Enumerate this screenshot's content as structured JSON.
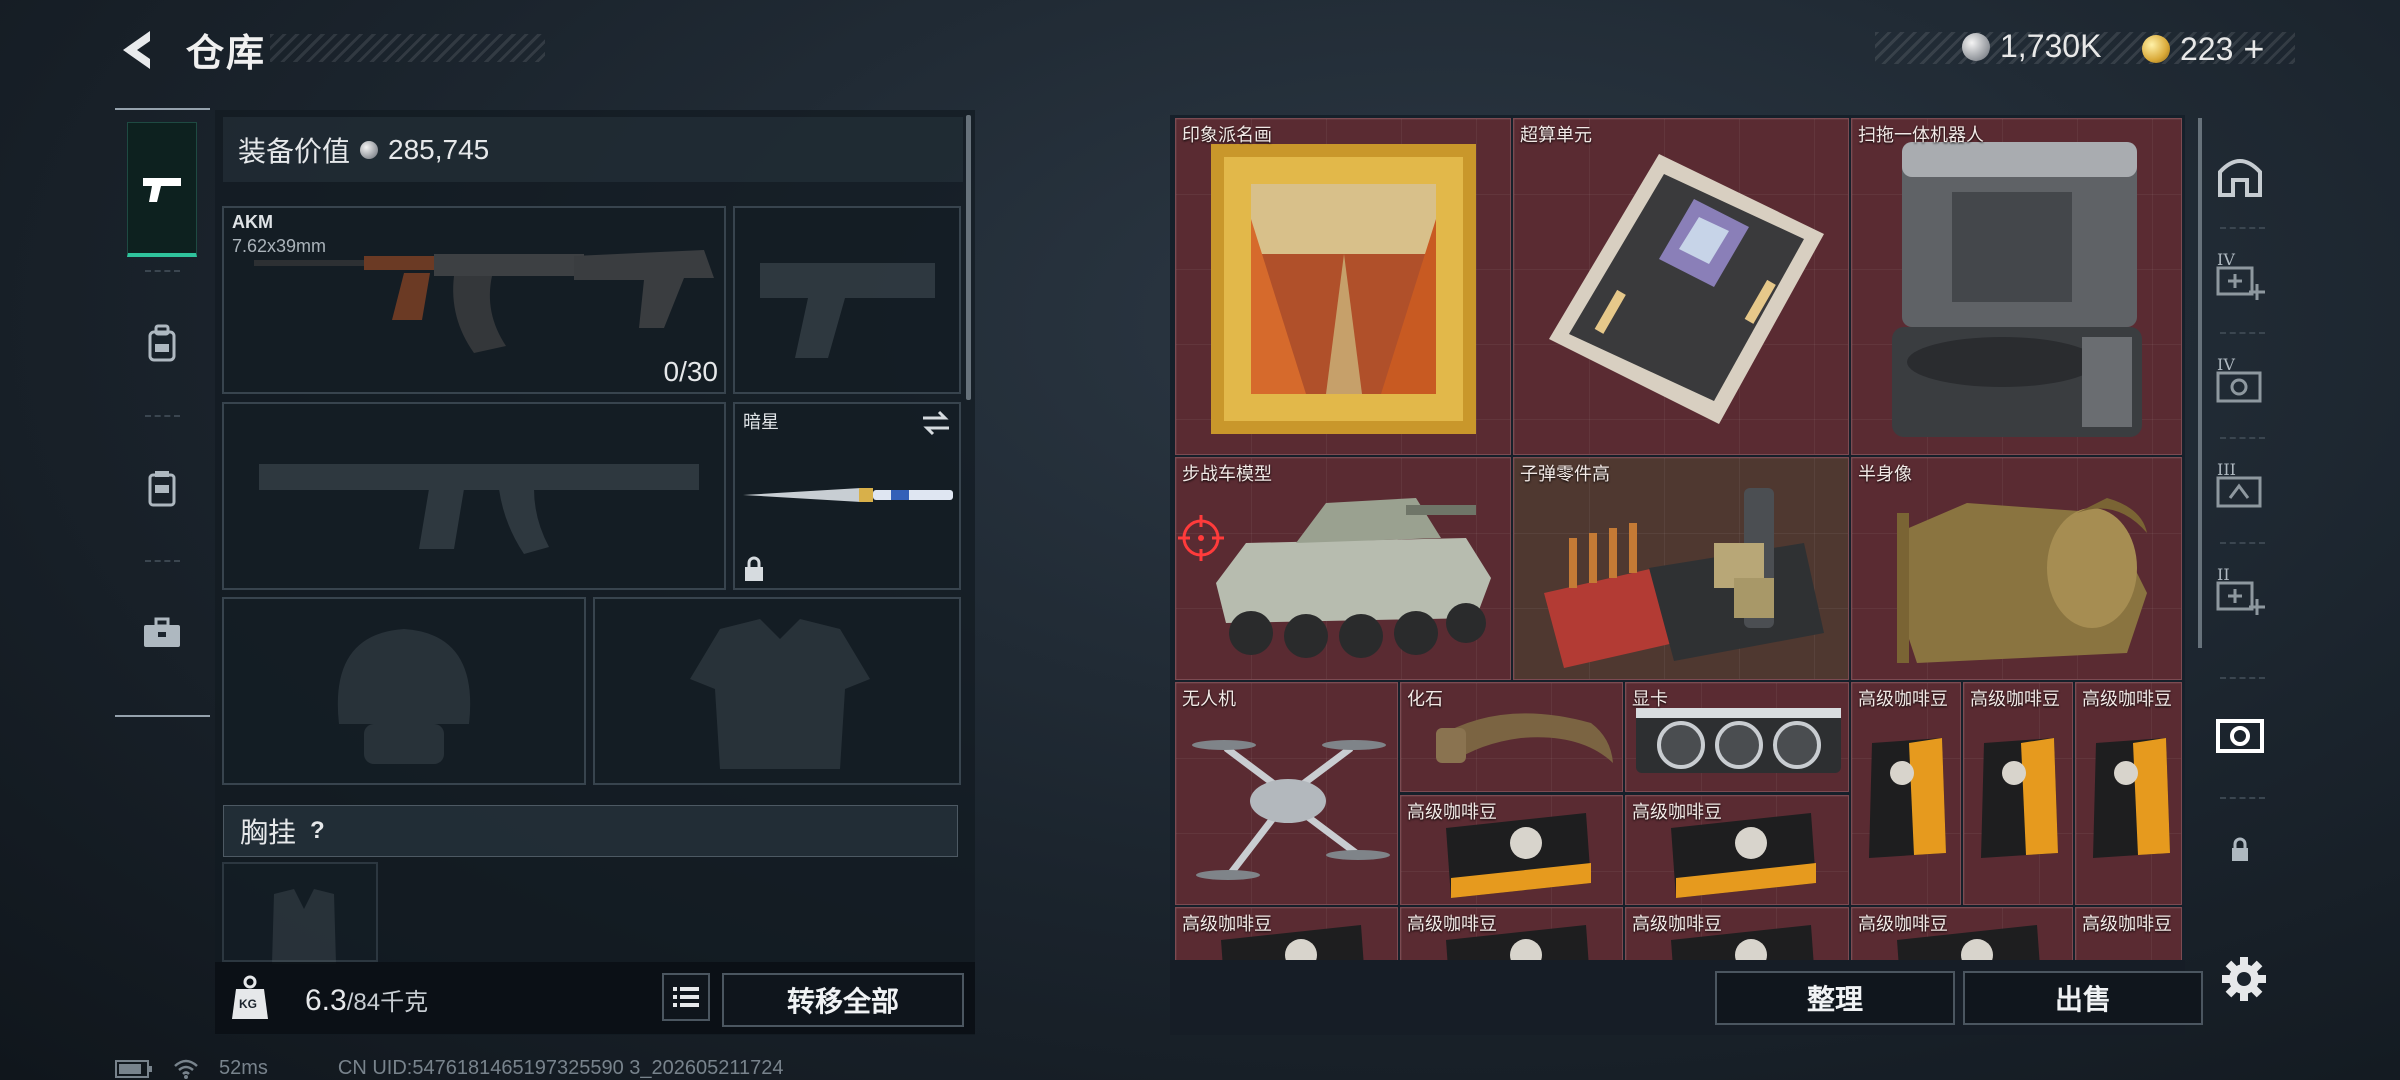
{
  "header": {
    "title": "仓库",
    "currency": [
      {
        "icon": "silver-coin-icon",
        "value": "1,730K"
      },
      {
        "icon": "gold-coin-icon",
        "value": "223"
      }
    ],
    "add_label": "+"
  },
  "sidenav": {
    "items": [
      {
        "name": "weapons",
        "icon": "pistol-icon",
        "active": true
      },
      {
        "name": "armor",
        "icon": "backpack-icon",
        "active": false
      },
      {
        "name": "gear",
        "icon": "chest-rig-icon",
        "active": false
      },
      {
        "name": "case",
        "icon": "toolbox-icon",
        "active": false
      }
    ]
  },
  "equipment": {
    "value_label": "装备价值",
    "value": "285,745",
    "primary": {
      "name": "AKM",
      "caliber": "7.62x39mm",
      "ammo": "0/30"
    },
    "melee": {
      "name": "暗星"
    },
    "chest_label": "胸挂",
    "help_icon": "?",
    "weight_current": "6.3",
    "weight_max": "/84千克",
    "weight_icon_label": "KG",
    "transfer_all_label": "转移全部"
  },
  "storage": {
    "items": [
      {
        "name": "印象派名画"
      },
      {
        "name": "超算单元"
      },
      {
        "name": "扫拖一体机器人"
      },
      {
        "name": "步战车模型"
      },
      {
        "name": "子弹零件高"
      },
      {
        "name": "半身像"
      },
      {
        "name": "无人机"
      },
      {
        "name": "化石"
      },
      {
        "name": "显卡"
      },
      {
        "name": "高级咖啡豆"
      },
      {
        "name": "高级咖啡豆"
      },
      {
        "name": "高级咖啡豆"
      },
      {
        "name": "高级咖啡豆"
      },
      {
        "name": "高级咖啡豆"
      },
      {
        "name": "高级咖啡豆"
      },
      {
        "name": "高级咖啡豆"
      },
      {
        "name": "高级咖啡豆"
      },
      {
        "name": "高级咖啡豆"
      },
      {
        "name": "高级咖啡豆"
      }
    ],
    "sort_label": "整理",
    "sell_label": "出售"
  },
  "rightnav": {
    "tabs": [
      {
        "icon": "home-icon",
        "tier": ""
      },
      {
        "icon": "medkit-add-icon",
        "tier": "IV"
      },
      {
        "icon": "case-icon",
        "tier": "IV"
      },
      {
        "icon": "case-icon",
        "tier": "III"
      },
      {
        "icon": "medkit-add-icon",
        "tier": "II"
      },
      {
        "icon": "case-icon",
        "tier": ""
      },
      {
        "icon": "lock-icon",
        "tier": ""
      }
    ]
  },
  "status": {
    "ping": "52ms",
    "uid": "CN UID:5476181465197325590 3_202605211724"
  },
  "colors": {
    "accent": "#2fc39c",
    "cell_bg": "#5a2b32",
    "cell_border": "#7c4b52"
  }
}
